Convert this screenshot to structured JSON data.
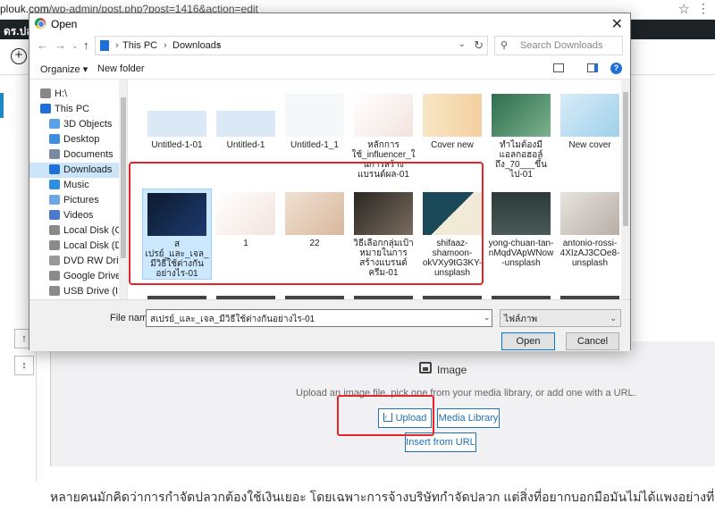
{
  "browser": {
    "url_host": "plouk.com",
    "url_path": "/wp-admin/post.php?post=1416&action=edit"
  },
  "wp": {
    "site_name": "ดร.ปล",
    "side_tool_1": "↑",
    "side_tool_2": "↕"
  },
  "image_block": {
    "title": "Image",
    "description": "Upload an image file, pick one from your media library, or add one with a URL.",
    "upload_label": "Upload",
    "media_library_label": "Media Library",
    "insert_url_label": "Insert from URL"
  },
  "body_text": "หลายคนมักคิดว่าการกำจัดปลวกต้องใช้เงินเยอะ โดยเฉพาะการจ้างบริษัทกำจัดปลวก แต่สิ่งที่อยากบอกมือมันไม่ได้แพงอย่างที่คิ",
  "dialog": {
    "title": "Open",
    "path": [
      "This PC",
      "Downloads"
    ],
    "search_placeholder": "Search Downloads",
    "organize_label": "Organize ▾",
    "new_folder_label": "New folder",
    "nav_items": [
      {
        "label": "H:\\",
        "icon": "drive-icon",
        "color": "#888888",
        "indent": 0
      },
      {
        "label": "This PC",
        "icon": "pc-icon",
        "color": "#1e6fd9",
        "indent": 0
      },
      {
        "label": "3D Objects",
        "icon": "cube-icon",
        "color": "#5aa0e8",
        "indent": 1
      },
      {
        "label": "Desktop",
        "icon": "desktop-icon",
        "color": "#3b8ee0",
        "indent": 1
      },
      {
        "label": "Documents",
        "icon": "documents-icon",
        "color": "#7a8aa0",
        "indent": 1
      },
      {
        "label": "Downloads",
        "icon": "download-icon",
        "color": "#1e6fd9",
        "indent": 1,
        "selected": true
      },
      {
        "label": "Music",
        "icon": "music-icon",
        "color": "#2d8fe0",
        "indent": 1
      },
      {
        "label": "Pictures",
        "icon": "pictures-icon",
        "color": "#6aa8e8",
        "indent": 1
      },
      {
        "label": "Videos",
        "icon": "videos-icon",
        "color": "#4a7ad0",
        "indent": 1
      },
      {
        "label": "Local Disk (C:)",
        "icon": "disk-icon",
        "color": "#8a8a8a",
        "indent": 1
      },
      {
        "label": "Local Disk (D:)",
        "icon": "disk-icon",
        "color": "#8a8a8a",
        "indent": 1
      },
      {
        "label": "DVD RW Drive (E",
        "icon": "dvd-icon",
        "color": "#9a9a9a",
        "indent": 1
      },
      {
        "label": "Google Drive File",
        "icon": "drive-icon",
        "color": "#8a8a8a",
        "indent": 1
      },
      {
        "label": "USB Drive (I:)",
        "icon": "usb-icon",
        "color": "#8a8a8a",
        "indent": 1
      }
    ],
    "files_row1": [
      {
        "name": "Untitled-1-01",
        "thumb": "t-blue"
      },
      {
        "name": "Untitled-1",
        "thumb": "t-blue"
      },
      {
        "name": "Untitled-1_1",
        "thumb": "t-white"
      },
      {
        "name": "หลักการใช้_influencer_ในการสร้างแบรนด์ผล-01",
        "thumb": "t-pink"
      },
      {
        "name": "Cover new",
        "thumb": "t-yellow"
      },
      {
        "name": "ทำไมต้องมีแอลกอฮอล์ถึง_70___ขึ้นไป-01",
        "thumb": "t-mint"
      },
      {
        "name": "New cover",
        "thumb": "t-ltblue"
      }
    ],
    "files_row2": [
      {
        "name": "สเปรย์_และ_เจล_มีวิธีใช้ต่างกันอย่างไร-01",
        "thumb": "t-dark",
        "selected": true
      },
      {
        "name": "1",
        "thumb": "t-pink"
      },
      {
        "name": "22",
        "thumb": "t-peach"
      },
      {
        "name": "วิธีเลือกกลุ่มเป้าหมายในการสร้างแบรนด์ครีม-01",
        "thumb": "t-grey"
      },
      {
        "name": "shifaaz-shamoon-okVXy9tG3KY-unsplash",
        "thumb": "t-sea"
      },
      {
        "name": "yong-chuan-tan-nMqdVApWNow-unsplash",
        "thumb": "t-darksea"
      },
      {
        "name": "antonio-rossi-4XIzAJ3COe8-unsplash",
        "thumb": "t-marble"
      }
    ],
    "file_name_label": "File name:",
    "file_name_value": "สเปรย์_และ_เจล_มีวิธีใช้ต่างกันอย่างไร-01",
    "file_type_value": "ไฟล์ภาพ",
    "open_label": "Open",
    "cancel_label": "Cancel"
  },
  "colors": {
    "highlight": "#e5252a",
    "wp_blue": "#2271b1",
    "selection": "#cce8ff"
  }
}
